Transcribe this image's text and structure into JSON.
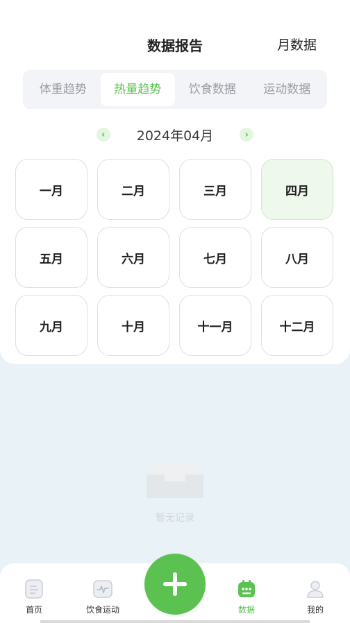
{
  "header": {
    "title": "数据报告",
    "month_data_link": "月数据"
  },
  "tabs": [
    {
      "label": "体重趋势",
      "active": false
    },
    {
      "label": "热量趋势",
      "active": true
    },
    {
      "label": "饮食数据",
      "active": false
    },
    {
      "label": "运动数据",
      "active": false
    }
  ],
  "month_nav": {
    "current": "2024年04月",
    "prev_icon": "chevron-left-icon",
    "next_icon": "chevron-right-icon"
  },
  "months": [
    "一月",
    "二月",
    "三月",
    "四月",
    "五月",
    "六月",
    "七月",
    "八月",
    "九月",
    "十月",
    "十一月",
    "十二月"
  ],
  "selected_month": "四月",
  "empty_state": {
    "text": "暂无记录",
    "icon": "inbox-icon"
  },
  "tabbar": {
    "items": [
      {
        "label": "首页",
        "icon": "document-icon"
      },
      {
        "label": "饮食运动",
        "icon": "pulse-icon"
      },
      {
        "label": "数据",
        "icon": "calendar-icon",
        "active": true
      },
      {
        "label": "我的",
        "icon": "user-icon"
      }
    ],
    "add_icon": "plus-icon"
  },
  "colors": {
    "accent": "#5bc251",
    "selected_bg": "#eef8ec",
    "page_bg": "#e9f2f6"
  }
}
